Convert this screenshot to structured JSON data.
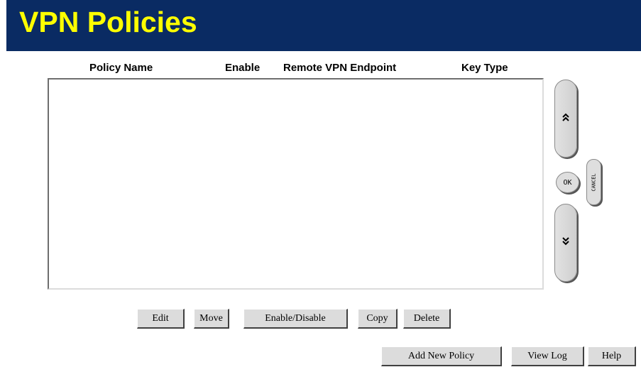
{
  "header": {
    "title": "VPN Policies",
    "background": "#0a2b63",
    "title_color": "#ffff00"
  },
  "table": {
    "columns": [
      "Policy Name",
      "Enable",
      "Remote VPN Endpoint",
      "Key Type"
    ],
    "rows": []
  },
  "nav": {
    "up_icon": "double-chevron-up-icon",
    "down_icon": "double-chevron-down-icon",
    "ok_label": "OK",
    "cancel_label": "CANCEL"
  },
  "actions": {
    "edit": "Edit",
    "move": "Move",
    "enable_disable": "Enable/Disable",
    "copy": "Copy",
    "delete": "Delete"
  },
  "footer": {
    "add_new_policy": "Add New Policy",
    "view_log": "View Log",
    "help": "Help"
  }
}
